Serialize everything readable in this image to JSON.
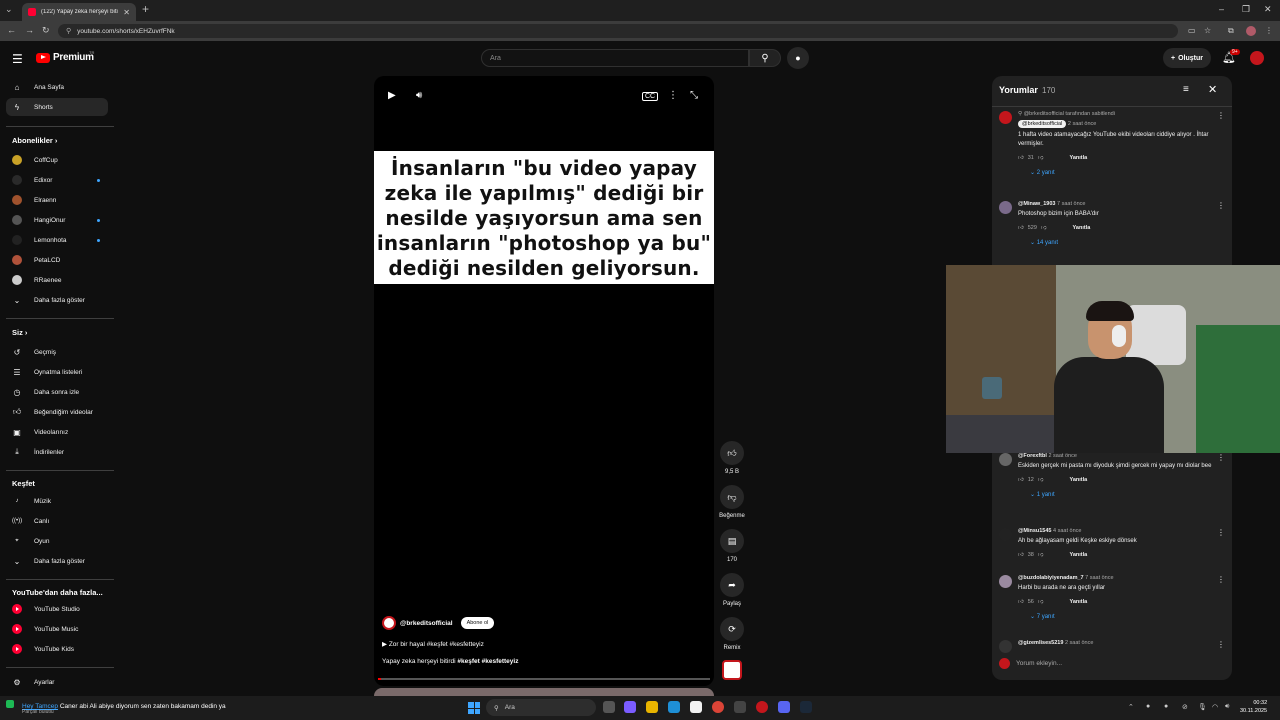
{
  "browser": {
    "tab_title": "(122) Yapay zeka herşeyi bitirdi",
    "url": "youtube.com/shorts/xEHZuvrfFNk"
  },
  "header": {
    "logo_text": "Premium",
    "logo_country": "TR",
    "search_placeholder": "Ara",
    "create_label": "Oluştur",
    "notification_badge": "9+"
  },
  "sidebar": {
    "main": [
      {
        "label": "Ana Sayfa",
        "icon": "home-icon"
      },
      {
        "label": "Shorts",
        "icon": "shorts-icon"
      }
    ],
    "subscriptions_heading": "Abonelikler",
    "subscriptions": [
      {
        "label": "CoffCup",
        "color": "#c9a227",
        "dot": false
      },
      {
        "label": "Edixor",
        "color": "#2a2a2a",
        "dot": true
      },
      {
        "label": "Elraenn",
        "color": "#a0522d",
        "dot": false
      },
      {
        "label": "HangiOnur",
        "color": "#555555",
        "dot": true
      },
      {
        "label": "Lemonhota",
        "color": "#222222",
        "dot": true
      },
      {
        "label": "PetaLCD",
        "color": "#b0523a",
        "dot": false
      },
      {
        "label": "RRaenee",
        "color": "#cccccc",
        "dot": false
      }
    ],
    "show_more_1": "Daha fazla göster",
    "you_heading": "Siz",
    "you_items": [
      {
        "label": "Geçmiş",
        "icon": "history-icon"
      },
      {
        "label": "Oynatma listeleri",
        "icon": "playlist-icon"
      },
      {
        "label": "Daha sonra izle",
        "icon": "watch-later-icon"
      },
      {
        "label": "Beğendiğim videolar",
        "icon": "like-icon"
      },
      {
        "label": "Videolarınız",
        "icon": "your-videos-icon"
      },
      {
        "label": "İndirilenler",
        "icon": "download-icon"
      }
    ],
    "explore_heading": "Keşfet",
    "explore_items": [
      {
        "label": "Müzik",
        "icon": "music-icon"
      },
      {
        "label": "Canlı",
        "icon": "live-icon"
      },
      {
        "label": "Oyun",
        "icon": "gaming-icon"
      }
    ],
    "show_more_2": "Daha fazla göster",
    "more_heading": "YouTube'dan daha fazla...",
    "more_items": [
      {
        "label": "YouTube Studio"
      },
      {
        "label": "YouTube Music"
      },
      {
        "label": "YouTube Kids"
      }
    ],
    "settings_label": "Ayarlar"
  },
  "video": {
    "caption": "İnsanların \"bu video yapay zeka ile yapılmış\" dediği bir nesilde yaşıyorsun ama sen insanların \"photoshop ya bu\" dediği nesilden geliyorsun.",
    "channel": "@brkeditsofficial",
    "subscribe_label": "Abone ol",
    "music": "Zor bir hayal #keşfet #kesfetteyiz",
    "description_text": "Yapay zeka herşeyi bitirdi",
    "description_tags": "#keşfet #kesfetteyiz",
    "progress": 0.01
  },
  "actions": {
    "like_count": "9,5 B",
    "dislike_label": "Beğenme",
    "comment_count": "170",
    "share_label": "Paylaş",
    "remix_label": "Remix"
  },
  "comments": {
    "title": "Yorumlar",
    "count": "170",
    "reply_label": "Yanıtla",
    "add_placeholder": "Yorum ekleyin...",
    "pinned_note": "@brkeditsofficial tarafından sabitlendi",
    "items": [
      {
        "user": "@brkeditsofficial",
        "time": "2 saat önce",
        "text": "1 hafta video atamayacağız YouTube ekibi videoları ciddiye alıyor . İhtar vermişler.",
        "likes": "31",
        "replies": "2 yanıt",
        "color": "#c4161c"
      },
      {
        "user": "@Minaw_1903",
        "time": "7 saat önce",
        "text": "Photoshop bizim için BABA'dır",
        "likes": "529",
        "replies": "14 yanıt",
        "color": "#7a6a8a"
      },
      {
        "user": "@Forexftbl",
        "time": "2 saat önce",
        "text": "Eskiden gerçek mi pasta mı diyoduk şimdi gercek mi yapay mı diolar bee",
        "likes": "12",
        "replies": "1 yanıt",
        "color": "#666666"
      },
      {
        "user": "@Minsu1545",
        "time": "4 saat önce",
        "text": "Ah be ağlayasam geldi Keşke eskiye dönsek",
        "likes": "38",
        "replies": "",
        "color": "#222222"
      },
      {
        "user": "@buzdolabiyiyenadam_7",
        "time": "7 saat önce",
        "text": "Harbi bu arada ne ara geçti yıllar",
        "likes": "56",
        "replies": "7 yanıt",
        "color": "#9a8aa0"
      },
      {
        "user": "@gizemlises5219",
        "time": "2 saat önce",
        "text": "",
        "likes": "",
        "replies": "",
        "color": "#333333"
      }
    ]
  },
  "taskbar": {
    "song_artist": "Hey Tamcep",
    "song_title": "Caner abi Ali abiye diyorum sen zaten bakamam dedin ya",
    "song_sub": "Parçalı bulutlu",
    "search_label": "Ara",
    "time": "00:32",
    "date": "30.11.2025"
  }
}
